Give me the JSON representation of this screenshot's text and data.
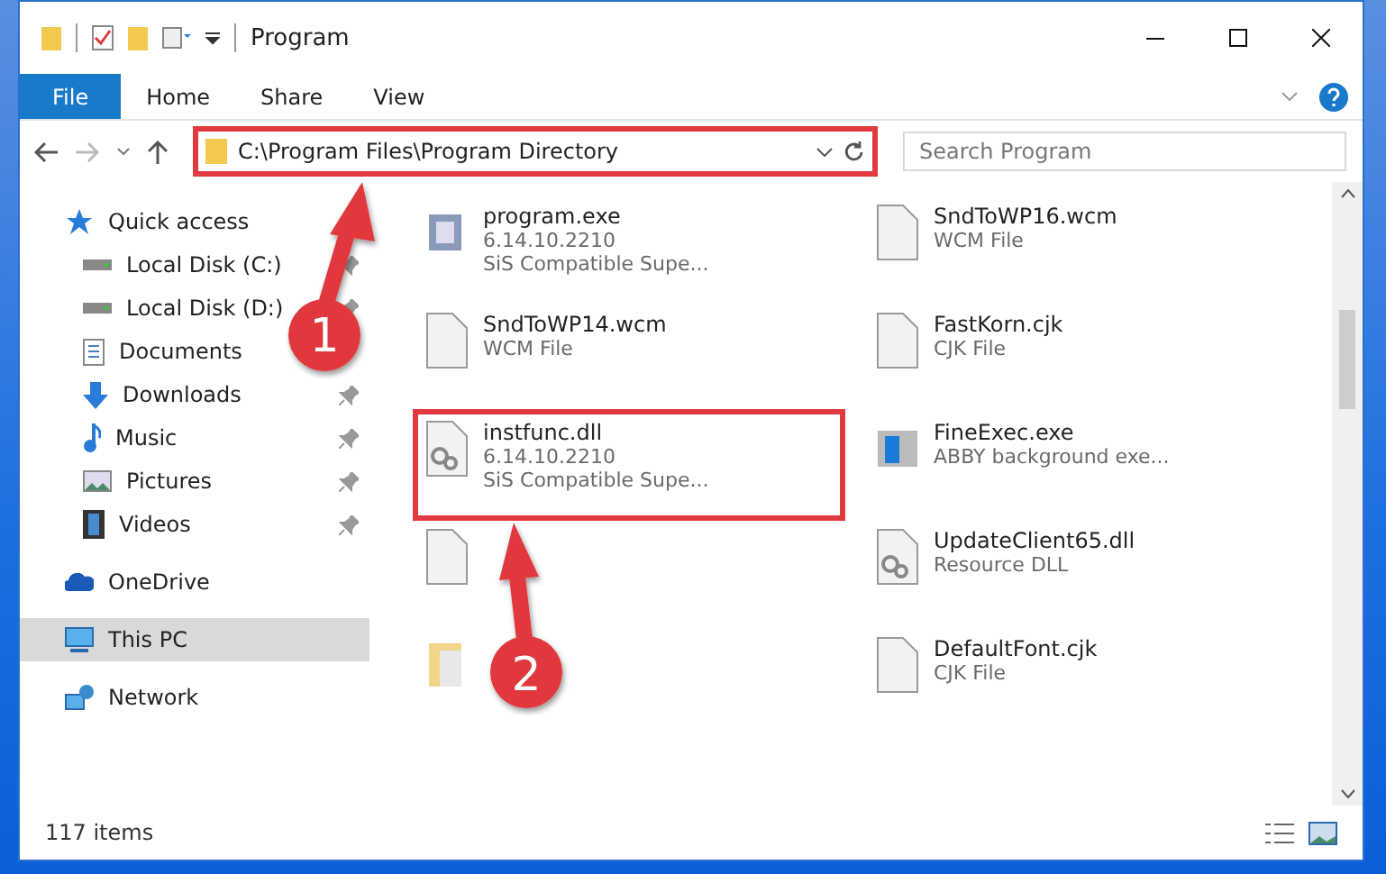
{
  "window": {
    "title": "Program"
  },
  "ribbon_tabs": [
    {
      "label": "File",
      "selected": true
    },
    {
      "label": "Home",
      "selected": false
    },
    {
      "label": "Share",
      "selected": false
    },
    {
      "label": "View",
      "selected": false
    }
  ],
  "address": {
    "value": "C:\\Program Files\\Program Directory",
    "highlighted": true
  },
  "search": {
    "placeholder": "Search Program"
  },
  "sidebar": {
    "items": [
      {
        "label": "Quick access",
        "kind": "star",
        "selected": false,
        "children": [
          {
            "label": "Local Disk (C:)",
            "kind": "disk",
            "pinned": true
          },
          {
            "label": "Local Disk (D:)",
            "kind": "disk",
            "pinned": true
          },
          {
            "label": "Documents",
            "kind": "document"
          },
          {
            "label": "Downloads",
            "kind": "download",
            "pinned": true
          },
          {
            "label": "Music",
            "kind": "music",
            "pinned": true
          },
          {
            "label": "Pictures",
            "kind": "pictures",
            "pinned": true
          },
          {
            "label": "Videos",
            "kind": "videos",
            "pinned": true
          }
        ]
      },
      {
        "label": "OneDrive",
        "kind": "cloud",
        "selected": false
      },
      {
        "label": "This PC",
        "kind": "pc",
        "selected": true
      },
      {
        "label": "Network",
        "kind": "network",
        "selected": false
      }
    ]
  },
  "files": [
    {
      "name": "program.exe",
      "lines": [
        "6.14.10.2210",
        "SiS Compatible Supe..."
      ],
      "kind": "exe",
      "highlighted": false
    },
    {
      "name": "SndToWP16.wcm",
      "lines": [
        "WCM File"
      ],
      "kind": "blank",
      "highlighted": false
    },
    {
      "name": "SndToWP14.wcm",
      "lines": [
        "WCM File"
      ],
      "kind": "blank",
      "highlighted": false
    },
    {
      "name": "FastKorn.cjk",
      "lines": [
        "CJK File"
      ],
      "kind": "blank",
      "highlighted": false
    },
    {
      "name": "instfunc.dll",
      "lines": [
        "6.14.10.2210",
        "SiS Compatible Supe..."
      ],
      "kind": "dll",
      "highlighted": true
    },
    {
      "name": "FineExec.exe",
      "lines": [
        "ABBY background exe..."
      ],
      "kind": "window",
      "highlighted": false
    },
    {
      "kind": "blank",
      "highlighted": false
    },
    {
      "name": "UpdateClient65.dll",
      "lines": [
        "Resource DLL"
      ],
      "kind": "dll",
      "highlighted": false
    },
    {
      "kind": "folderish",
      "highlighted": false
    },
    {
      "name": "DefaultFont.cjk",
      "lines": [
        "CJK File"
      ],
      "kind": "blank",
      "highlighted": false
    }
  ],
  "status_bar": {
    "count": "117 items"
  },
  "callouts": [
    {
      "number": "1"
    },
    {
      "number": "2"
    }
  ]
}
